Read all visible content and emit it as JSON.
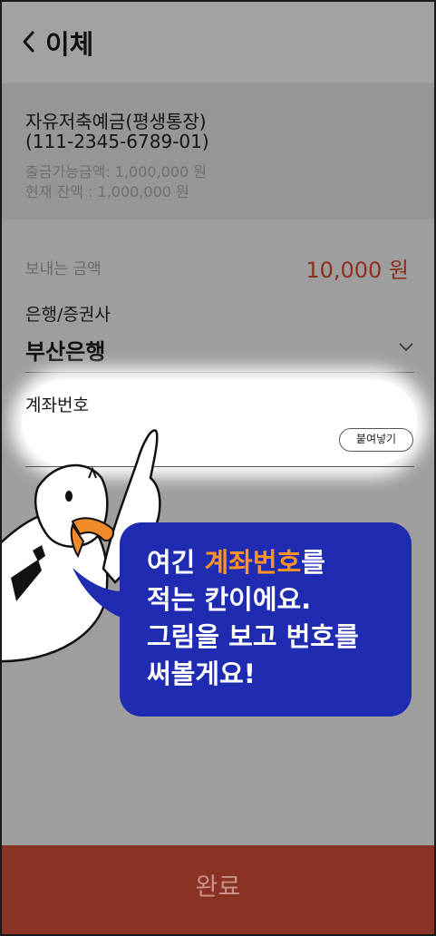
{
  "header": {
    "title": "이체"
  },
  "account": {
    "name": "자유저축예금(평생통장)",
    "number": "(111-2345-6789-01)",
    "available": "출금가능금액: 1,000,000 원",
    "balance": "현재 잔액 : 1,000,000 원"
  },
  "transfer": {
    "amount_label": "보내는 금액",
    "amount_value": "10,000 원",
    "bank_label": "은행/증권사",
    "bank_value": "부산은행",
    "account_no_label": "계좌번호",
    "paste_label": "붙여넣기"
  },
  "bubble": {
    "line1_prefix": "여긴 ",
    "line1_highlight": "계좌번호",
    "line1_suffix": "를",
    "line2": "적는 칸이에요.",
    "line3": "그림을 보고 번호를",
    "line4": "써볼게요!"
  },
  "footer": {
    "done_label": "완료"
  },
  "colors": {
    "overlay_gray": "#9e9e9e",
    "amount_red": "#8e2e20",
    "bubble_blue": "#1f2bb0",
    "highlight_orange": "#ff9324",
    "footer_brown": "#8a3324"
  }
}
